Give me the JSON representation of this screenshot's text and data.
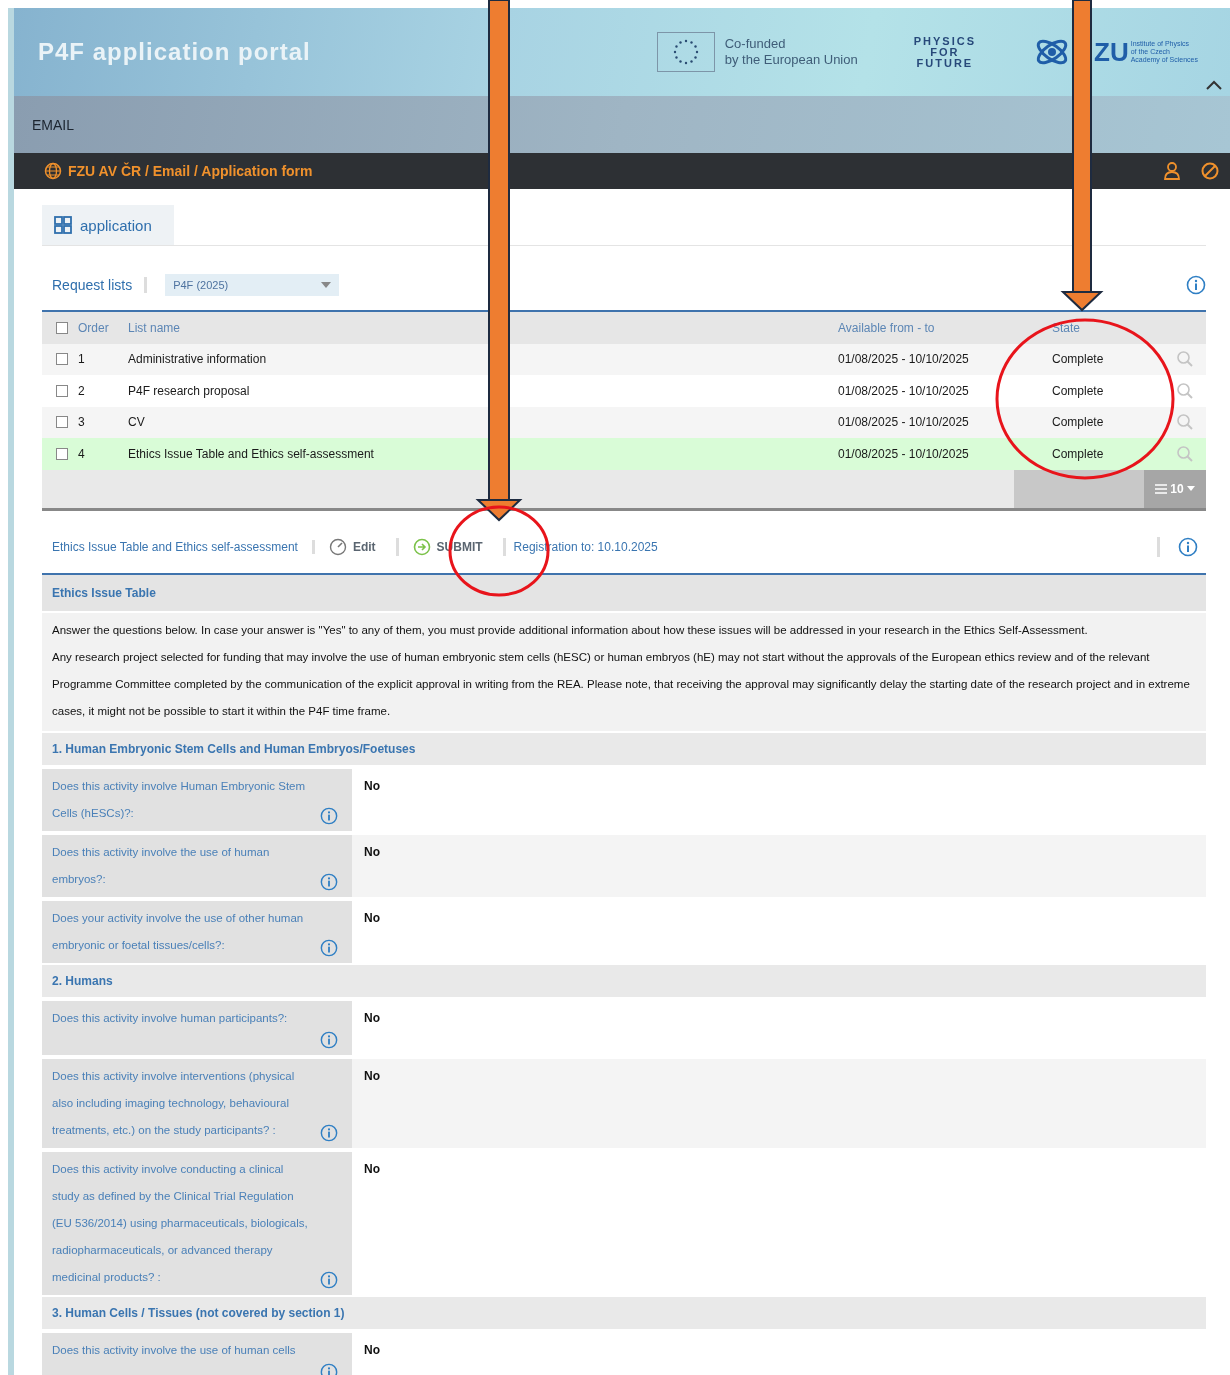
{
  "header": {
    "title": "P4F application portal",
    "eu_text": [
      "Co-funded",
      "by the European Union"
    ],
    "physics_logo": [
      "PHYSICS",
      "FOR",
      "FUTURE"
    ],
    "fzu_logo": "ZU",
    "fzu_small": [
      "Institute of Physics",
      "of the Czech",
      "Academy of Sciences"
    ]
  },
  "section_label": "EMAIL",
  "breadcrumb": "FZU AV ČR / Email / Application form",
  "tab": {
    "label": "application",
    "selected": true
  },
  "request_lists": {
    "label": "Request lists",
    "select_value": "P4F (2025)"
  },
  "table": {
    "all_checked": false,
    "columns": [
      "Order",
      "List name",
      "Available from - to",
      "State"
    ],
    "rows": [
      {
        "order": "1",
        "name": "Administrative information",
        "available": "01/08/2025 - 10/10/2025",
        "state": "Complete",
        "selected": false,
        "checked": false
      },
      {
        "order": "2",
        "name": "P4F research proposal",
        "available": "01/08/2025 - 10/10/2025",
        "state": "Complete",
        "selected": false,
        "checked": false
      },
      {
        "order": "3",
        "name": "CV",
        "available": "01/08/2025 - 10/10/2025",
        "state": "Complete",
        "selected": false,
        "checked": false
      },
      {
        "order": "4",
        "name": "Ethics Issue Table and Ethics self-assessment",
        "available": "01/08/2025 - 10/10/2025",
        "state": "Complete",
        "selected": true,
        "checked": false
      }
    ],
    "page_size": "10"
  },
  "form_toolbar": {
    "title": "Ethics Issue Table and Ethics self-assessment",
    "edit": "Edit",
    "submit": "SUBMIT",
    "registration": "Registration to: 10.10.2025"
  },
  "form_title": "Ethics Issue Table",
  "intro": [
    "Answer the questions below. In case your answer is \"Yes\" to any of them, you must provide additional information about how these issues will be addressed in your research in the Ethics Self-Assessment.",
    "Any research project selected for funding that may involve the use of human embryonic stem cells (hESC) or human embryos (hE) may not start without the approvals of the European ethics review and of the relevant Programme Committee completed by the communication of the explicit approval in writing from the REA. Please note, that receiving the approval may significantly delay the starting date of the research project and in extreme cases, it might not be possible to start it within the P4F time frame."
  ],
  "sections": [
    {
      "title": "1. Human Embryonic Stem Cells and Human Embryos/Foetuses",
      "questions": [
        {
          "label": "Does this activity involve Human Embryonic Stem Cells (hESCs)?:",
          "answer": "No"
        },
        {
          "label": "Does this activity involve the use of human embryos?:",
          "answer": "No"
        },
        {
          "label": "Does your activity involve the use of other human embryonic or foetal tissues/cells?:",
          "answer": "No"
        }
      ]
    },
    {
      "title": "2. Humans",
      "questions": [
        {
          "label": "Does this activity involve human participants?:",
          "answer": "No"
        },
        {
          "label": "Does this activity involve interventions (physical also including imaging technology, behavioural treatments, etc.) on the study participants? :",
          "answer": "No"
        },
        {
          "label": "Does this activity involve conducting a clinical study as defined by the Clinical Trial Regulation (EU 536/2014) using pharmaceuticals, biologicals, radiopharmaceuticals, or advanced therapy medicinal products? :",
          "answer": "No"
        }
      ]
    },
    {
      "title": "3. Human Cells / Tissues (not covered by section 1)",
      "questions": [
        {
          "label": "Does this activity involve the use of human cells",
          "answer": "No"
        }
      ]
    }
  ]
}
